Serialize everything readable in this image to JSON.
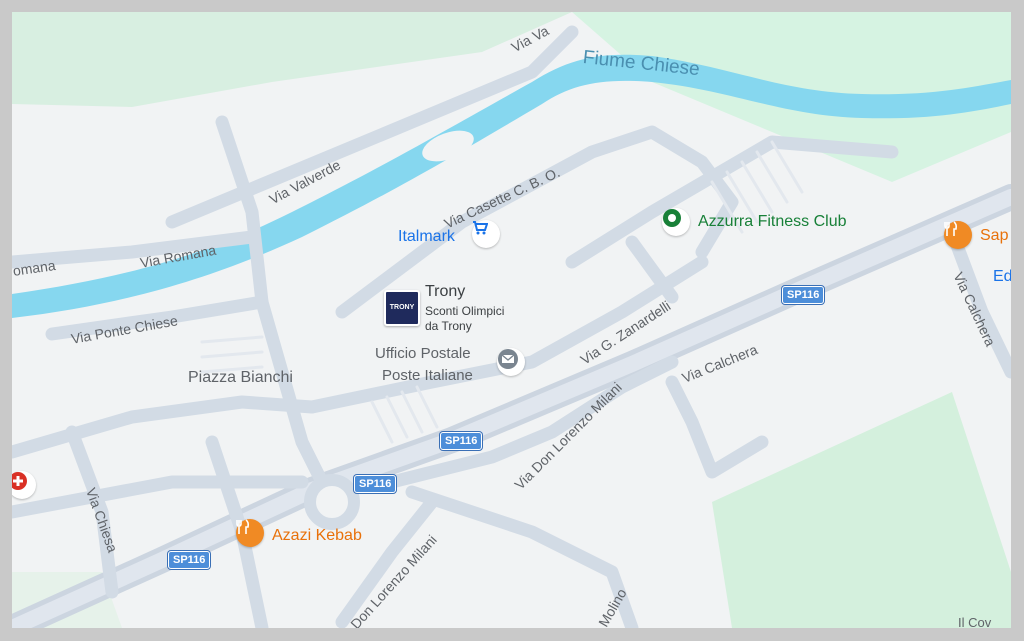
{
  "map": {
    "river": {
      "name": "Fiume Chiese"
    },
    "roads": [
      {
        "id": "via-valverde-top",
        "label": "Via Va"
      },
      {
        "id": "via-valverde",
        "label": "Via Valverde"
      },
      {
        "id": "via-casette",
        "label": "Via Casette C. B. O."
      },
      {
        "id": "via-romana-left",
        "label": "omana"
      },
      {
        "id": "via-romana",
        "label": "Via Romana"
      },
      {
        "id": "via-ponte-chiese",
        "label": "Via Ponte Chiese"
      },
      {
        "id": "via-zanardelli",
        "label": "Via G. Zanardelli"
      },
      {
        "id": "via-calchera",
        "label": "Via Calchera"
      },
      {
        "id": "via-calchera-right",
        "label": "Via Calchera"
      },
      {
        "id": "via-don-lorenzo-milani",
        "label": "Via Don Lorenzo Milani"
      },
      {
        "id": "don-lorenzo-milani-lower",
        "label": "Don Lorenzo Milani"
      },
      {
        "id": "via-chiesa",
        "label": "Via Chiesa"
      },
      {
        "id": "molino",
        "label": "Molino"
      },
      {
        "id": "il-cov",
        "label": "Il Cov"
      }
    ],
    "shields": [
      "SP116",
      "SP116",
      "SP116",
      "SP116"
    ],
    "places": [
      {
        "id": "piazza-bianchi",
        "label": "Piazza Bianchi"
      }
    ],
    "pois": {
      "italmark": {
        "label": "Italmark",
        "icon": "shopping-cart-icon",
        "color": "#1a73e8"
      },
      "azzurra": {
        "label": "Azzurra Fitness Club",
        "icon": "fitness-pin-icon",
        "color": "#188038"
      },
      "trony": {
        "title": "Trony",
        "sub1": "Sconti Olimpici",
        "sub2": "da Trony",
        "logo": "TRONY"
      },
      "ufficio": {
        "line1": "Ufficio Postale",
        "line2": "Poste Italiane",
        "icon": "mail-icon"
      },
      "azazi": {
        "label": "Azazi Kebab",
        "icon": "restaurant-icon",
        "color": "#e8710a"
      },
      "sap": {
        "label": "Sap",
        "icon": "restaurant-icon",
        "color": "#e8710a"
      },
      "ed": {
        "label": "Ed"
      },
      "hospital": {
        "icon": "medical-cross-icon",
        "color": "#d93025"
      }
    },
    "colors": {
      "background": "#f1f3f4",
      "water": "#86d7ef",
      "park": "#d6f0e0",
      "road": "#d5dde6",
      "shield": "#4d8ed9"
    }
  }
}
